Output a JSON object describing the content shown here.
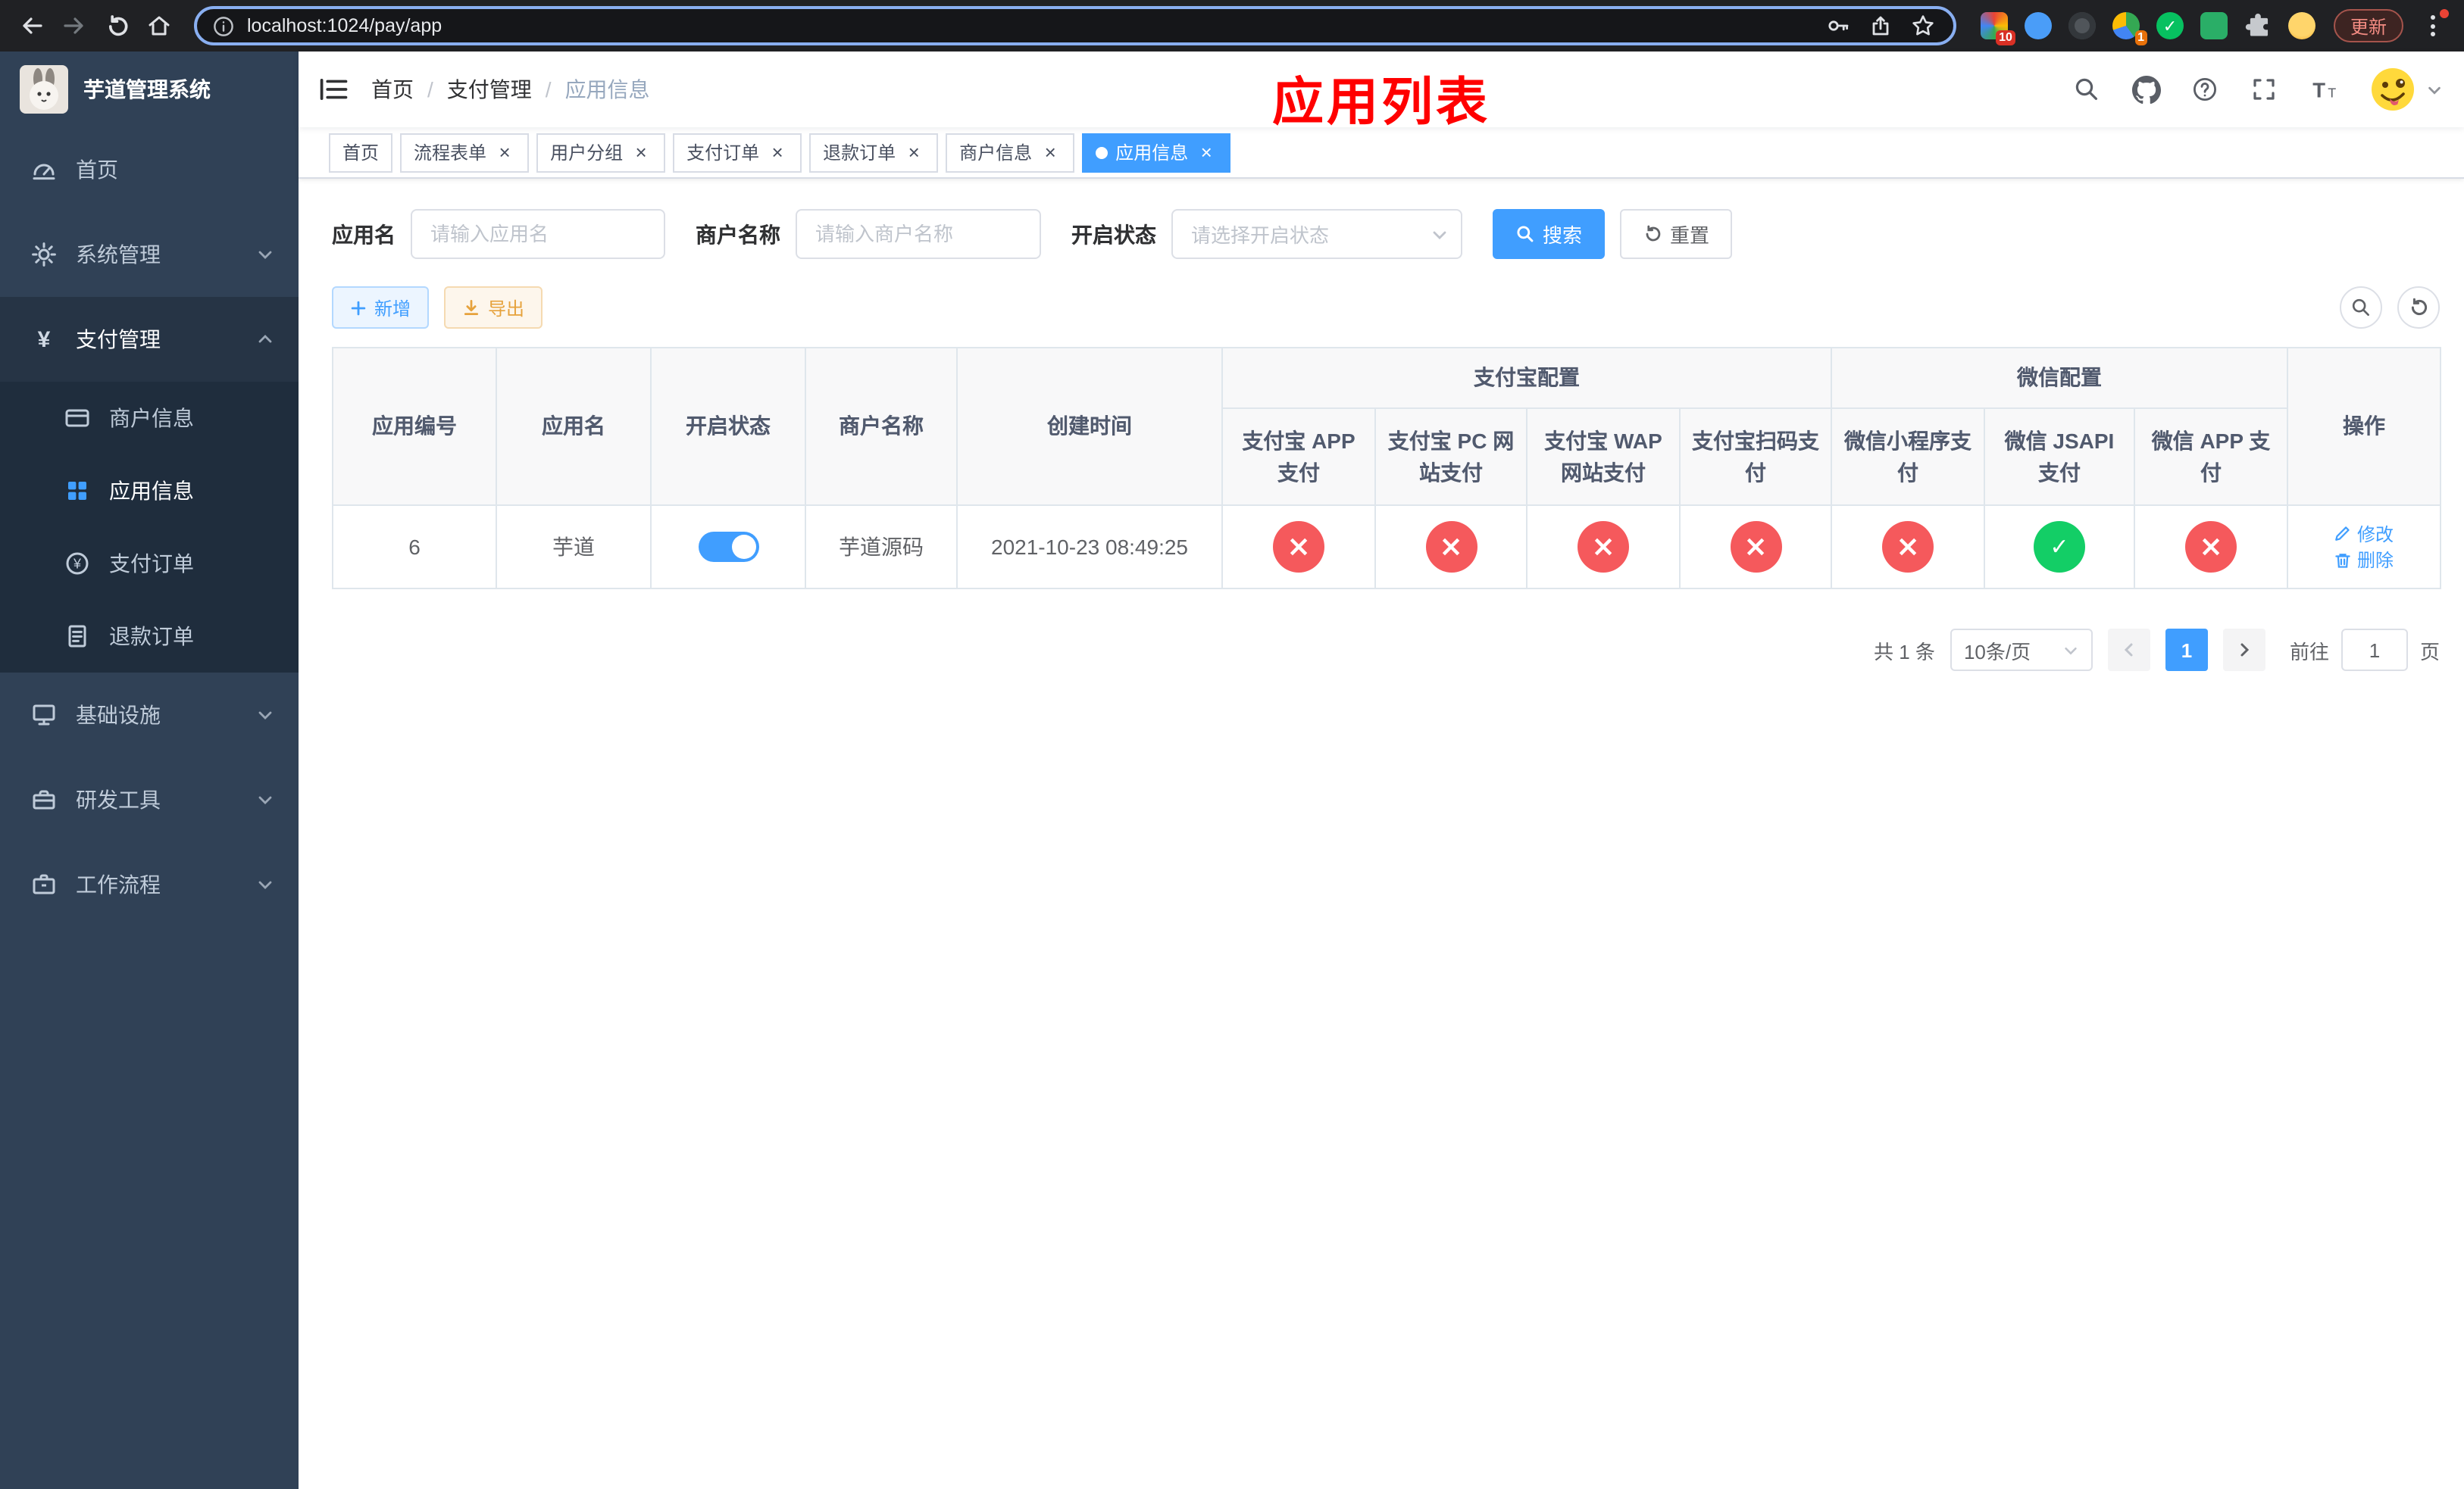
{
  "browser": {
    "url": "localhost:1024/pay/app",
    "update_label": "更新",
    "ext_badge_one": "10",
    "ext_badge_two": "1"
  },
  "sidebar": {
    "title": "芋道管理系统",
    "home": "首页",
    "system": "系统管理",
    "payment": "支付管理",
    "merchant_info": "商户信息",
    "app_info": "应用信息",
    "pay_order": "支付订单",
    "refund_order": "退款订单",
    "infrastructure": "基础设施",
    "dev_tools": "研发工具",
    "workflow": "工作流程"
  },
  "navbar": {
    "breadcrumb_home": "首页",
    "breadcrumb_section": "支付管理",
    "breadcrumb_current": "应用信息",
    "annotation": "应用列表"
  },
  "tabs": {
    "home": "首页",
    "flow_form": "流程表单",
    "user_group": "用户分组",
    "pay_order": "支付订单",
    "refund_order": "退款订单",
    "merchant_info": "商户信息",
    "app_info": "应用信息"
  },
  "filters": {
    "app_name_label": "应用名",
    "app_name_placeholder": "请输入应用名",
    "merchant_label": "商户名称",
    "merchant_placeholder": "请输入商户名称",
    "status_label": "开启状态",
    "status_placeholder": "请选择开启状态",
    "search_label": "搜索",
    "reset_label": "重置"
  },
  "toolbar": {
    "add_label": "新增",
    "export_label": "导出"
  },
  "table": {
    "headers": {
      "app_id": "应用编号",
      "app_name": "应用名",
      "status": "开启状态",
      "merchant_name": "商户名称",
      "create_time": "创建时间",
      "alipay_group": "支付宝配置",
      "wechat_group": "微信配置",
      "alipay_app": "支付宝 APP 支付",
      "alipay_pc": "支付宝 PC 网站支付",
      "alipay_wap": "支付宝 WAP 网站支付",
      "alipay_qr": "支付宝扫码支付",
      "wechat_lite": "微信小程序支付",
      "wechat_jsapi": "微信 JSAPI 支付",
      "wechat_app": "微信 APP 支付",
      "actions": "操作"
    },
    "row": {
      "app_id": "6",
      "app_name": "芋道",
      "switch_state": "on",
      "merchant_name": "芋道源码",
      "create_time": "2021-10-23 08:49:25",
      "channels": [
        "fail",
        "fail",
        "fail",
        "fail",
        "fail",
        "success",
        "fail"
      ],
      "edit_label": "修改",
      "delete_label": "删除"
    }
  },
  "pagination": {
    "total": "共 1 条",
    "page_size": "10条/页",
    "page": "1",
    "goto_label": "前往",
    "goto_value": "1",
    "unit_label": "页"
  },
  "colors": {
    "primary": "#409eff",
    "success": "#13ce66",
    "danger": "#f5595c",
    "warning": "#e6a23c",
    "sidebar_bg": "#304156",
    "submenu_bg": "#1f2d3d",
    "annotation": "#ff0000"
  }
}
